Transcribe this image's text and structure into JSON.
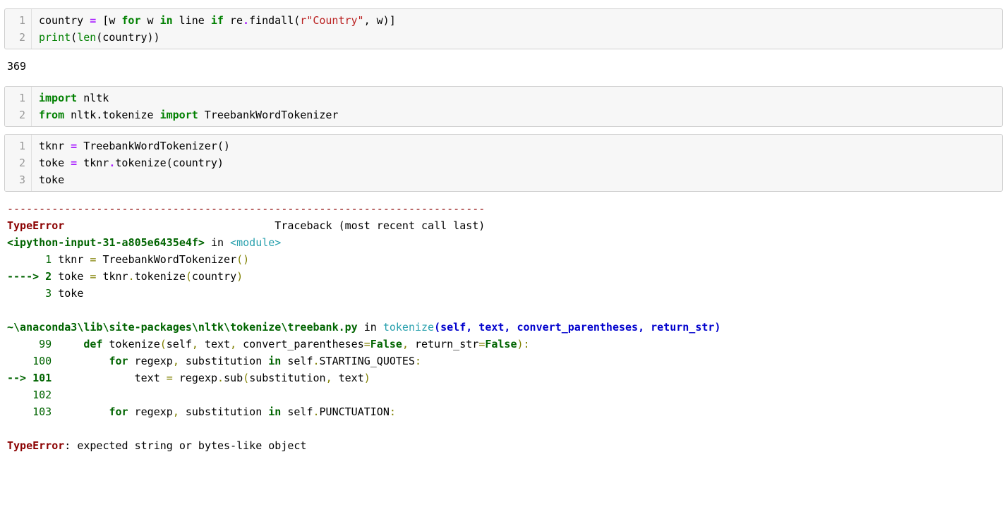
{
  "cells": [
    {
      "lines": [
        {
          "num": "1",
          "tokens": [
            {
              "t": "country ",
              "c": "c-plain"
            },
            {
              "t": "=",
              "c": "c-op"
            },
            {
              "t": " [w ",
              "c": "c-plain"
            },
            {
              "t": "for",
              "c": "c-kw"
            },
            {
              "t": " w ",
              "c": "c-plain"
            },
            {
              "t": "in",
              "c": "c-kw"
            },
            {
              "t": " line ",
              "c": "c-plain"
            },
            {
              "t": "if",
              "c": "c-kw"
            },
            {
              "t": " re",
              "c": "c-plain"
            },
            {
              "t": ".",
              "c": "c-op"
            },
            {
              "t": "findall(",
              "c": "c-plain"
            },
            {
              "t": "r\"Country\"",
              "c": "c-str"
            },
            {
              "t": ", w)]",
              "c": "c-plain"
            }
          ]
        },
        {
          "num": "2",
          "tokens": [
            {
              "t": "print",
              "c": "c-bi"
            },
            {
              "t": "(",
              "c": "c-plain"
            },
            {
              "t": "len",
              "c": "c-bi"
            },
            {
              "t": "(country))",
              "c": "c-plain"
            }
          ]
        }
      ],
      "output": "369"
    },
    {
      "lines": [
        {
          "num": "1",
          "tokens": [
            {
              "t": "import",
              "c": "c-kw"
            },
            {
              "t": " ",
              "c": "c-plain"
            },
            {
              "t": "nltk",
              "c": "c-bluei"
            }
          ]
        },
        {
          "num": "2",
          "tokens": [
            {
              "t": "from",
              "c": "c-kw"
            },
            {
              "t": " ",
              "c": "c-plain"
            },
            {
              "t": "nltk.tokenize",
              "c": "c-bluei"
            },
            {
              "t": " ",
              "c": "c-plain"
            },
            {
              "t": "import",
              "c": "c-kw"
            },
            {
              "t": " TreebankWordTokenizer",
              "c": "c-plain"
            }
          ]
        }
      ]
    },
    {
      "lines": [
        {
          "num": "1",
          "tokens": [
            {
              "t": "tknr ",
              "c": "c-plain"
            },
            {
              "t": "=",
              "c": "c-op"
            },
            {
              "t": " TreebankWordTokenizer()",
              "c": "c-plain"
            }
          ]
        },
        {
          "num": "2",
          "tokens": [
            {
              "t": "toke ",
              "c": "c-plain"
            },
            {
              "t": "=",
              "c": "c-op"
            },
            {
              "t": " tknr",
              "c": "c-plain"
            },
            {
              "t": ".",
              "c": "c-op"
            },
            {
              "t": "tokenize(country)",
              "c": "c-plain"
            }
          ]
        },
        {
          "num": "3",
          "tokens": [
            {
              "t": "toke",
              "c": "c-plain"
            }
          ]
        }
      ],
      "traceback": [
        [
          {
            "t": "---------------------------------------------------------------------------",
            "c": "e-red"
          }
        ],
        [
          {
            "t": "TypeError",
            "c": "e-redb"
          },
          {
            "t": "                                 Traceback (most recent call last)",
            "c": "e-black"
          }
        ],
        [
          {
            "t": "<ipython-input-31-a805e6435e4f>",
            "c": "e-greenb"
          },
          {
            "t": " in ",
            "c": "e-black"
          },
          {
            "t": "<module>",
            "c": "e-cyan"
          }
        ],
        [
          {
            "t": "      1",
            "c": "e-green"
          },
          {
            "t": " tknr ",
            "c": "e-black"
          },
          {
            "t": "=",
            "c": "e-yellow"
          },
          {
            "t": " TreebankWordTokenizer",
            "c": "e-black"
          },
          {
            "t": "()",
            "c": "e-yellow"
          }
        ],
        [
          {
            "t": "----> 2",
            "c": "e-greenb"
          },
          {
            "t": " toke ",
            "c": "e-black"
          },
          {
            "t": "=",
            "c": "e-yellow"
          },
          {
            "t": " tknr",
            "c": "e-black"
          },
          {
            "t": ".",
            "c": "e-yellow"
          },
          {
            "t": "tokenize",
            "c": "e-black"
          },
          {
            "t": "(",
            "c": "e-yellow"
          },
          {
            "t": "country",
            "c": "e-black"
          },
          {
            "t": ")",
            "c": "e-yellow"
          }
        ],
        [
          {
            "t": "      3",
            "c": "e-green"
          },
          {
            "t": " toke",
            "c": "e-black"
          }
        ],
        [
          {
            "t": "",
            "c": "e-black"
          }
        ],
        [
          {
            "t": "~\\anaconda3\\lib\\site-packages\\nltk\\tokenize\\treebank.py",
            "c": "e-greenb"
          },
          {
            "t": " in ",
            "c": "e-black"
          },
          {
            "t": "tokenize",
            "c": "e-cyan"
          },
          {
            "t": "(self, text, convert_parentheses, return_str)",
            "c": "e-bluei"
          }
        ],
        [
          {
            "t": "     99",
            "c": "e-green"
          },
          {
            "t": "     ",
            "c": "e-black"
          },
          {
            "t": "def",
            "c": "e-greenb"
          },
          {
            "t": " tokenize",
            "c": "e-black"
          },
          {
            "t": "(",
            "c": "e-yellow"
          },
          {
            "t": "self",
            "c": "e-black"
          },
          {
            "t": ",",
            "c": "e-yellow"
          },
          {
            "t": " text",
            "c": "e-black"
          },
          {
            "t": ",",
            "c": "e-yellow"
          },
          {
            "t": " convert_parentheses",
            "c": "e-black"
          },
          {
            "t": "=",
            "c": "e-yellow"
          },
          {
            "t": "False",
            "c": "e-greenb"
          },
          {
            "t": ",",
            "c": "e-yellow"
          },
          {
            "t": " return_str",
            "c": "e-black"
          },
          {
            "t": "=",
            "c": "e-yellow"
          },
          {
            "t": "False",
            "c": "e-greenb"
          },
          {
            "t": "):",
            "c": "e-yellow"
          }
        ],
        [
          {
            "t": "    100",
            "c": "e-green"
          },
          {
            "t": "         ",
            "c": "e-black"
          },
          {
            "t": "for",
            "c": "e-greenb"
          },
          {
            "t": " regexp",
            "c": "e-black"
          },
          {
            "t": ",",
            "c": "e-yellow"
          },
          {
            "t": " substitution ",
            "c": "e-black"
          },
          {
            "t": "in",
            "c": "e-greenb"
          },
          {
            "t": " self",
            "c": "e-black"
          },
          {
            "t": ".",
            "c": "e-yellow"
          },
          {
            "t": "STARTING_QUOTES",
            "c": "e-black"
          },
          {
            "t": ":",
            "c": "e-yellow"
          }
        ],
        [
          {
            "t": "--> 101",
            "c": "e-greenb"
          },
          {
            "t": "             text ",
            "c": "e-black"
          },
          {
            "t": "=",
            "c": "e-yellow"
          },
          {
            "t": " regexp",
            "c": "e-black"
          },
          {
            "t": ".",
            "c": "e-yellow"
          },
          {
            "t": "sub",
            "c": "e-black"
          },
          {
            "t": "(",
            "c": "e-yellow"
          },
          {
            "t": "substitution",
            "c": "e-black"
          },
          {
            "t": ",",
            "c": "e-yellow"
          },
          {
            "t": " text",
            "c": "e-black"
          },
          {
            "t": ")",
            "c": "e-yellow"
          }
        ],
        [
          {
            "t": "    102",
            "c": "e-green"
          },
          {
            "t": " ",
            "c": "e-black"
          }
        ],
        [
          {
            "t": "    103",
            "c": "e-green"
          },
          {
            "t": "         ",
            "c": "e-black"
          },
          {
            "t": "for",
            "c": "e-greenb"
          },
          {
            "t": " regexp",
            "c": "e-black"
          },
          {
            "t": ",",
            "c": "e-yellow"
          },
          {
            "t": " substitution ",
            "c": "e-black"
          },
          {
            "t": "in",
            "c": "e-greenb"
          },
          {
            "t": " self",
            "c": "e-black"
          },
          {
            "t": ".",
            "c": "e-yellow"
          },
          {
            "t": "PUNCTUATION",
            "c": "e-black"
          },
          {
            "t": ":",
            "c": "e-yellow"
          }
        ],
        [
          {
            "t": "",
            "c": "e-black"
          }
        ],
        [
          {
            "t": "TypeError",
            "c": "e-redb"
          },
          {
            "t": ": expected string or bytes-like object",
            "c": "e-black"
          }
        ]
      ]
    }
  ]
}
